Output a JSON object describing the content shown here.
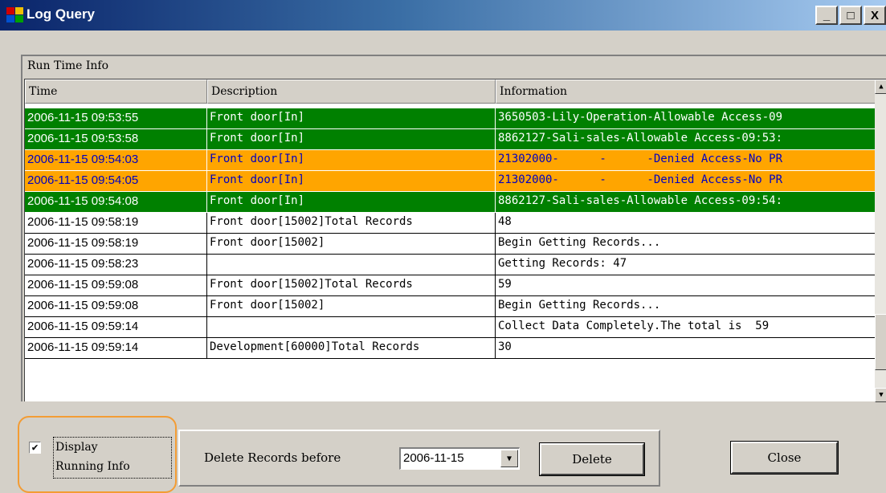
{
  "window": {
    "title": "Log Query",
    "controls": {
      "minimize": "_",
      "maximize": "□",
      "close": "X"
    }
  },
  "panel": {
    "caption": "Run Time Info"
  },
  "grid": {
    "columns": [
      "Time",
      "Description",
      "Information"
    ],
    "rows": [
      {
        "status": "green",
        "time": "2006-11-15 09:53:55",
        "description": "Front door[In]",
        "information": "3650503-Lily-Operation-Allowable Access-09"
      },
      {
        "status": "green",
        "time": "2006-11-15 09:53:58",
        "description": "Front door[In]",
        "information": "8862127-Sali-sales-Allowable Access-09:53:"
      },
      {
        "status": "orange",
        "time": "2006-11-15 09:54:03",
        "description": "Front door[In]",
        "information": "21302000-      -      -Denied Access-No PR"
      },
      {
        "status": "orange",
        "time": "2006-11-15 09:54:05",
        "description": "Front door[In]",
        "information": "21302000-      -      -Denied Access-No PR"
      },
      {
        "status": "green",
        "time": "2006-11-15 09:54:08",
        "description": "Front door[In]",
        "information": "8862127-Sali-sales-Allowable Access-09:54:"
      },
      {
        "status": "white",
        "time": "2006-11-15 09:58:19",
        "description": "Front door[15002]Total Records",
        "information": "48"
      },
      {
        "status": "white",
        "time": "2006-11-15 09:58:19",
        "description": "Front door[15002]",
        "information": "Begin Getting Records..."
      },
      {
        "status": "white",
        "time": "2006-11-15 09:58:23",
        "description": "",
        "information": "Getting Records: 47"
      },
      {
        "status": "white",
        "time": "2006-11-15 09:59:08",
        "description": "Front door[15002]Total Records",
        "information": "59"
      },
      {
        "status": "white",
        "time": "2006-11-15 09:59:08",
        "description": "Front door[15002]",
        "information": "Begin Getting Records..."
      },
      {
        "status": "white",
        "time": "2006-11-15 09:59:14",
        "description": "",
        "information": "Collect Data Completely.The total is  59"
      },
      {
        "status": "white",
        "time": "2006-11-15 09:59:14",
        "description": "Development[60000]Total Records",
        "information": "30"
      }
    ]
  },
  "options": {
    "display_running_info_label": "Display\nRunning Info",
    "display_running_info_checked": true,
    "check_mark": "✔"
  },
  "delete": {
    "label": "Delete Records before",
    "date_value": "2006-11-15",
    "button": "Delete"
  },
  "close_button": "Close",
  "colors": {
    "green_row": "#008000",
    "orange_row": "#ffa500",
    "highlight_border": "#f39c34"
  }
}
